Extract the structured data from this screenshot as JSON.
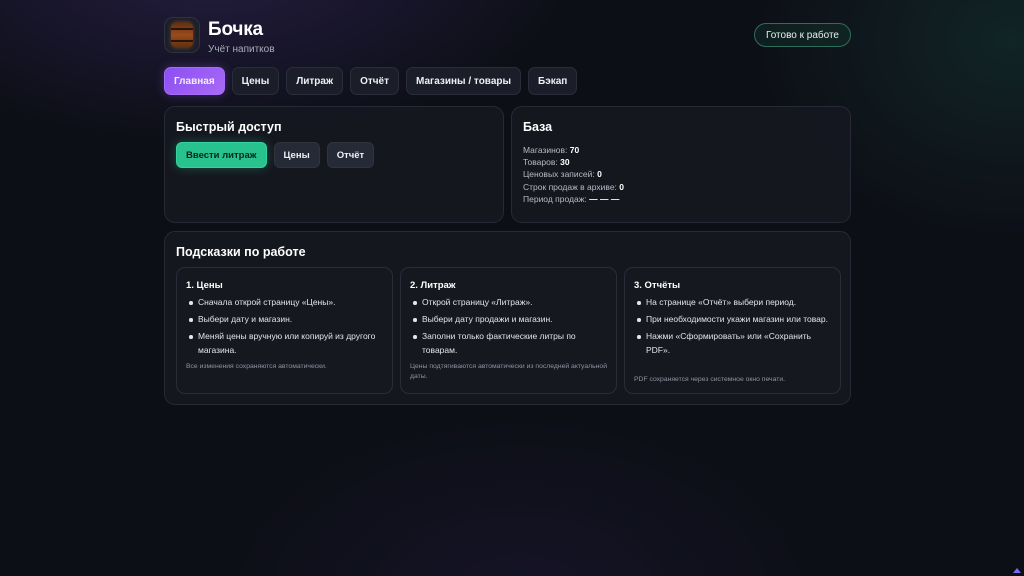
{
  "app": {
    "title": "Бочка",
    "subtitle": "Учёт напитков",
    "status": "Готово к работе",
    "logo_icon": "barrel-icon"
  },
  "tabs": [
    {
      "label": "Главная",
      "active": true
    },
    {
      "label": "Цены",
      "active": false
    },
    {
      "label": "Литраж",
      "active": false
    },
    {
      "label": "Отчёт",
      "active": false
    },
    {
      "label": "Магазины / товары",
      "active": false
    },
    {
      "label": "Бэкап",
      "active": false
    }
  ],
  "quick_access": {
    "title": "Быстрый доступ",
    "buttons": [
      {
        "label": "Ввести литраж"
      },
      {
        "label": "Цены"
      },
      {
        "label": "Отчёт"
      }
    ]
  },
  "database": {
    "title": "База",
    "stats": [
      {
        "label": "Магазинов:",
        "value": "70"
      },
      {
        "label": "Товаров:",
        "value": "30"
      },
      {
        "label": "Ценовых записей:",
        "value": "0"
      },
      {
        "label": "Строк продаж в архиве:",
        "value": "0"
      },
      {
        "label": "Период продаж:",
        "value": "— — —"
      }
    ]
  },
  "tips": {
    "title": "Подсказки по работе",
    "cards": [
      {
        "title": "1. Цены",
        "items": [
          "Сначала открой страницу «Цены».",
          "Выбери дату и магазин.",
          "Меняй цены вручную или копируй из другого магазина."
        ],
        "note": "Все изменения сохраняются автоматически."
      },
      {
        "title": "2. Литраж",
        "items": [
          "Открой страницу «Литраж».",
          "Выбери дату продажи и магазин.",
          "Заполни только фактические литры по товарам."
        ],
        "note": "Цены подтягиваются автоматически из последней актуальной даты."
      },
      {
        "title": "3. Отчёты",
        "items": [
          "На странице «Отчёт» выбери период.",
          "При необходимости укажи магазин или товар.",
          "Нажми «Сформировать» или «Сохранить PDF»."
        ],
        "note": "PDF сохраняется через системное окно печати."
      }
    ]
  },
  "colors": {
    "accent": "#9a5cf4",
    "primary_button": "#28c28f",
    "background": "#0d0f17"
  }
}
